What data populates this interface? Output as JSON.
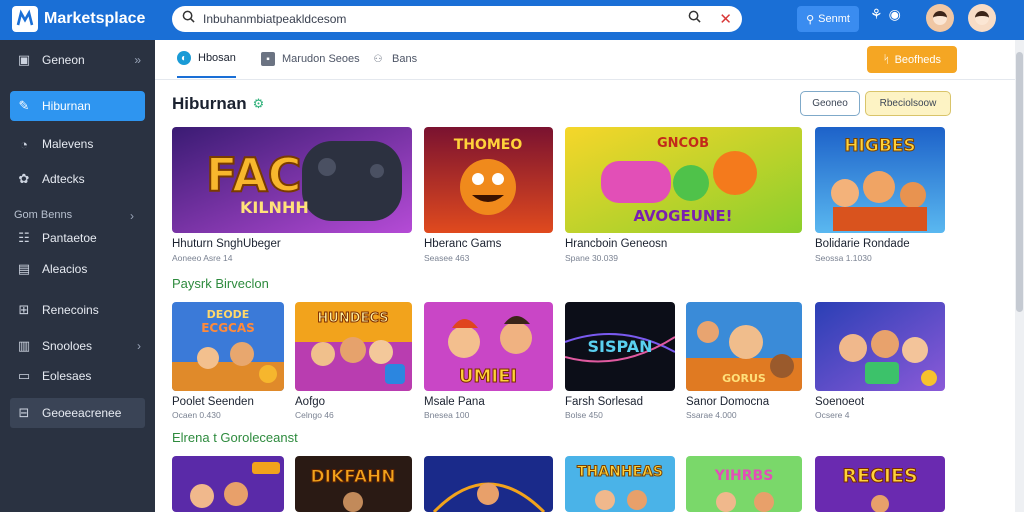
{
  "app": {
    "logo_text": "Marketsplace",
    "search_value": "Inbuhanmbiatpeakldcesom",
    "search_button_label": "Senmt"
  },
  "sidebar": {
    "items": [
      {
        "label": "Geneon",
        "icon": "grid-icon"
      },
      {
        "label": "Hiburnan",
        "icon": "wand-icon"
      },
      {
        "label": "Malevens",
        "icon": "gauge-icon"
      },
      {
        "label": "Adtecks",
        "icon": "palette-icon"
      },
      {
        "label": "Pantaetoe",
        "icon": "list-icon"
      },
      {
        "label": "Aleacios",
        "icon": "document-icon"
      },
      {
        "label": "Renecoins",
        "icon": "table-icon"
      },
      {
        "label": "Snooloes",
        "icon": "column-icon"
      },
      {
        "label": "Eolesaes",
        "icon": "monitor-icon"
      },
      {
        "label": "Geoeeacrenee",
        "icon": "calendar-icon"
      }
    ],
    "section_label": "Gom Benns"
  },
  "tabs": [
    {
      "label": "Hbosan",
      "icon": "globe-icon"
    },
    {
      "label": "Marudon Seoes",
      "icon": "chat-icon"
    },
    {
      "label": "Bans",
      "icon": "user-icon"
    }
  ],
  "header_button": "Beofheds",
  "page": {
    "title": "Hiburnan",
    "filter_buttons": [
      "Geoneo",
      "Rbeciolsoow"
    ]
  },
  "sections": [
    {
      "title": "",
      "cards": [
        {
          "title": "Hhuturn SnghUbeger",
          "sub": "Aoneeo Asre 14"
        },
        {
          "title": "Hberanc Gams",
          "sub": "Seasee 463"
        },
        {
          "title": "Hrancboin Geneosn",
          "sub": "Spane 30.039"
        },
        {
          "title": "Bolidarie Rondade",
          "sub": "Seossa 1.1030"
        }
      ]
    },
    {
      "title": "Paysrk Birveclon",
      "cards": [
        {
          "title": "Poolet Seenden",
          "sub": "Ocaen 0.430"
        },
        {
          "title": "Aofgo",
          "sub": "Celngo 46"
        },
        {
          "title": "Msale Pana",
          "sub": "Bnesea 100"
        },
        {
          "title": "Farsh Sorlesad",
          "sub": "Bolse 450"
        },
        {
          "title": "Sanor Domocna",
          "sub": "Ssarae 4.000"
        },
        {
          "title": "Soenoeot",
          "sub": "Ocsere 4"
        }
      ]
    },
    {
      "title": "Elrena t Goroleceanst",
      "cards": [
        {
          "title": "",
          "sub": ""
        },
        {
          "title": "",
          "sub": ""
        },
        {
          "title": "",
          "sub": ""
        },
        {
          "title": "",
          "sub": ""
        },
        {
          "title": "",
          "sub": ""
        },
        {
          "title": "",
          "sub": ""
        }
      ]
    }
  ],
  "thumb_text": {
    "r1c1": "FAC",
    "r1c1b": "KILNHH",
    "r1c2": "THOMEO",
    "r1c3": "GNCOB",
    "r1c3b": "AVOGEUNE!",
    "r1c4": "HIGBES",
    "r2c1": "DEODE",
    "r2c1b": "ECGCAS",
    "r2c2": "HUNDECS",
    "r2c3": "UMIEI",
    "r2c4": "SISPAN",
    "r2c5": "GORUS",
    "r3c2": "DIKFAHN",
    "r3c4": "THANHEAS",
    "r3c5": "YIHRBS",
    "r3c6": "RECIES"
  },
  "colors": {
    "topbar": "#1a6fd6",
    "sidebar": "#2a3241",
    "active": "#2e95f0",
    "orange": "#f5a623",
    "section_green": "#2e8b3e"
  }
}
